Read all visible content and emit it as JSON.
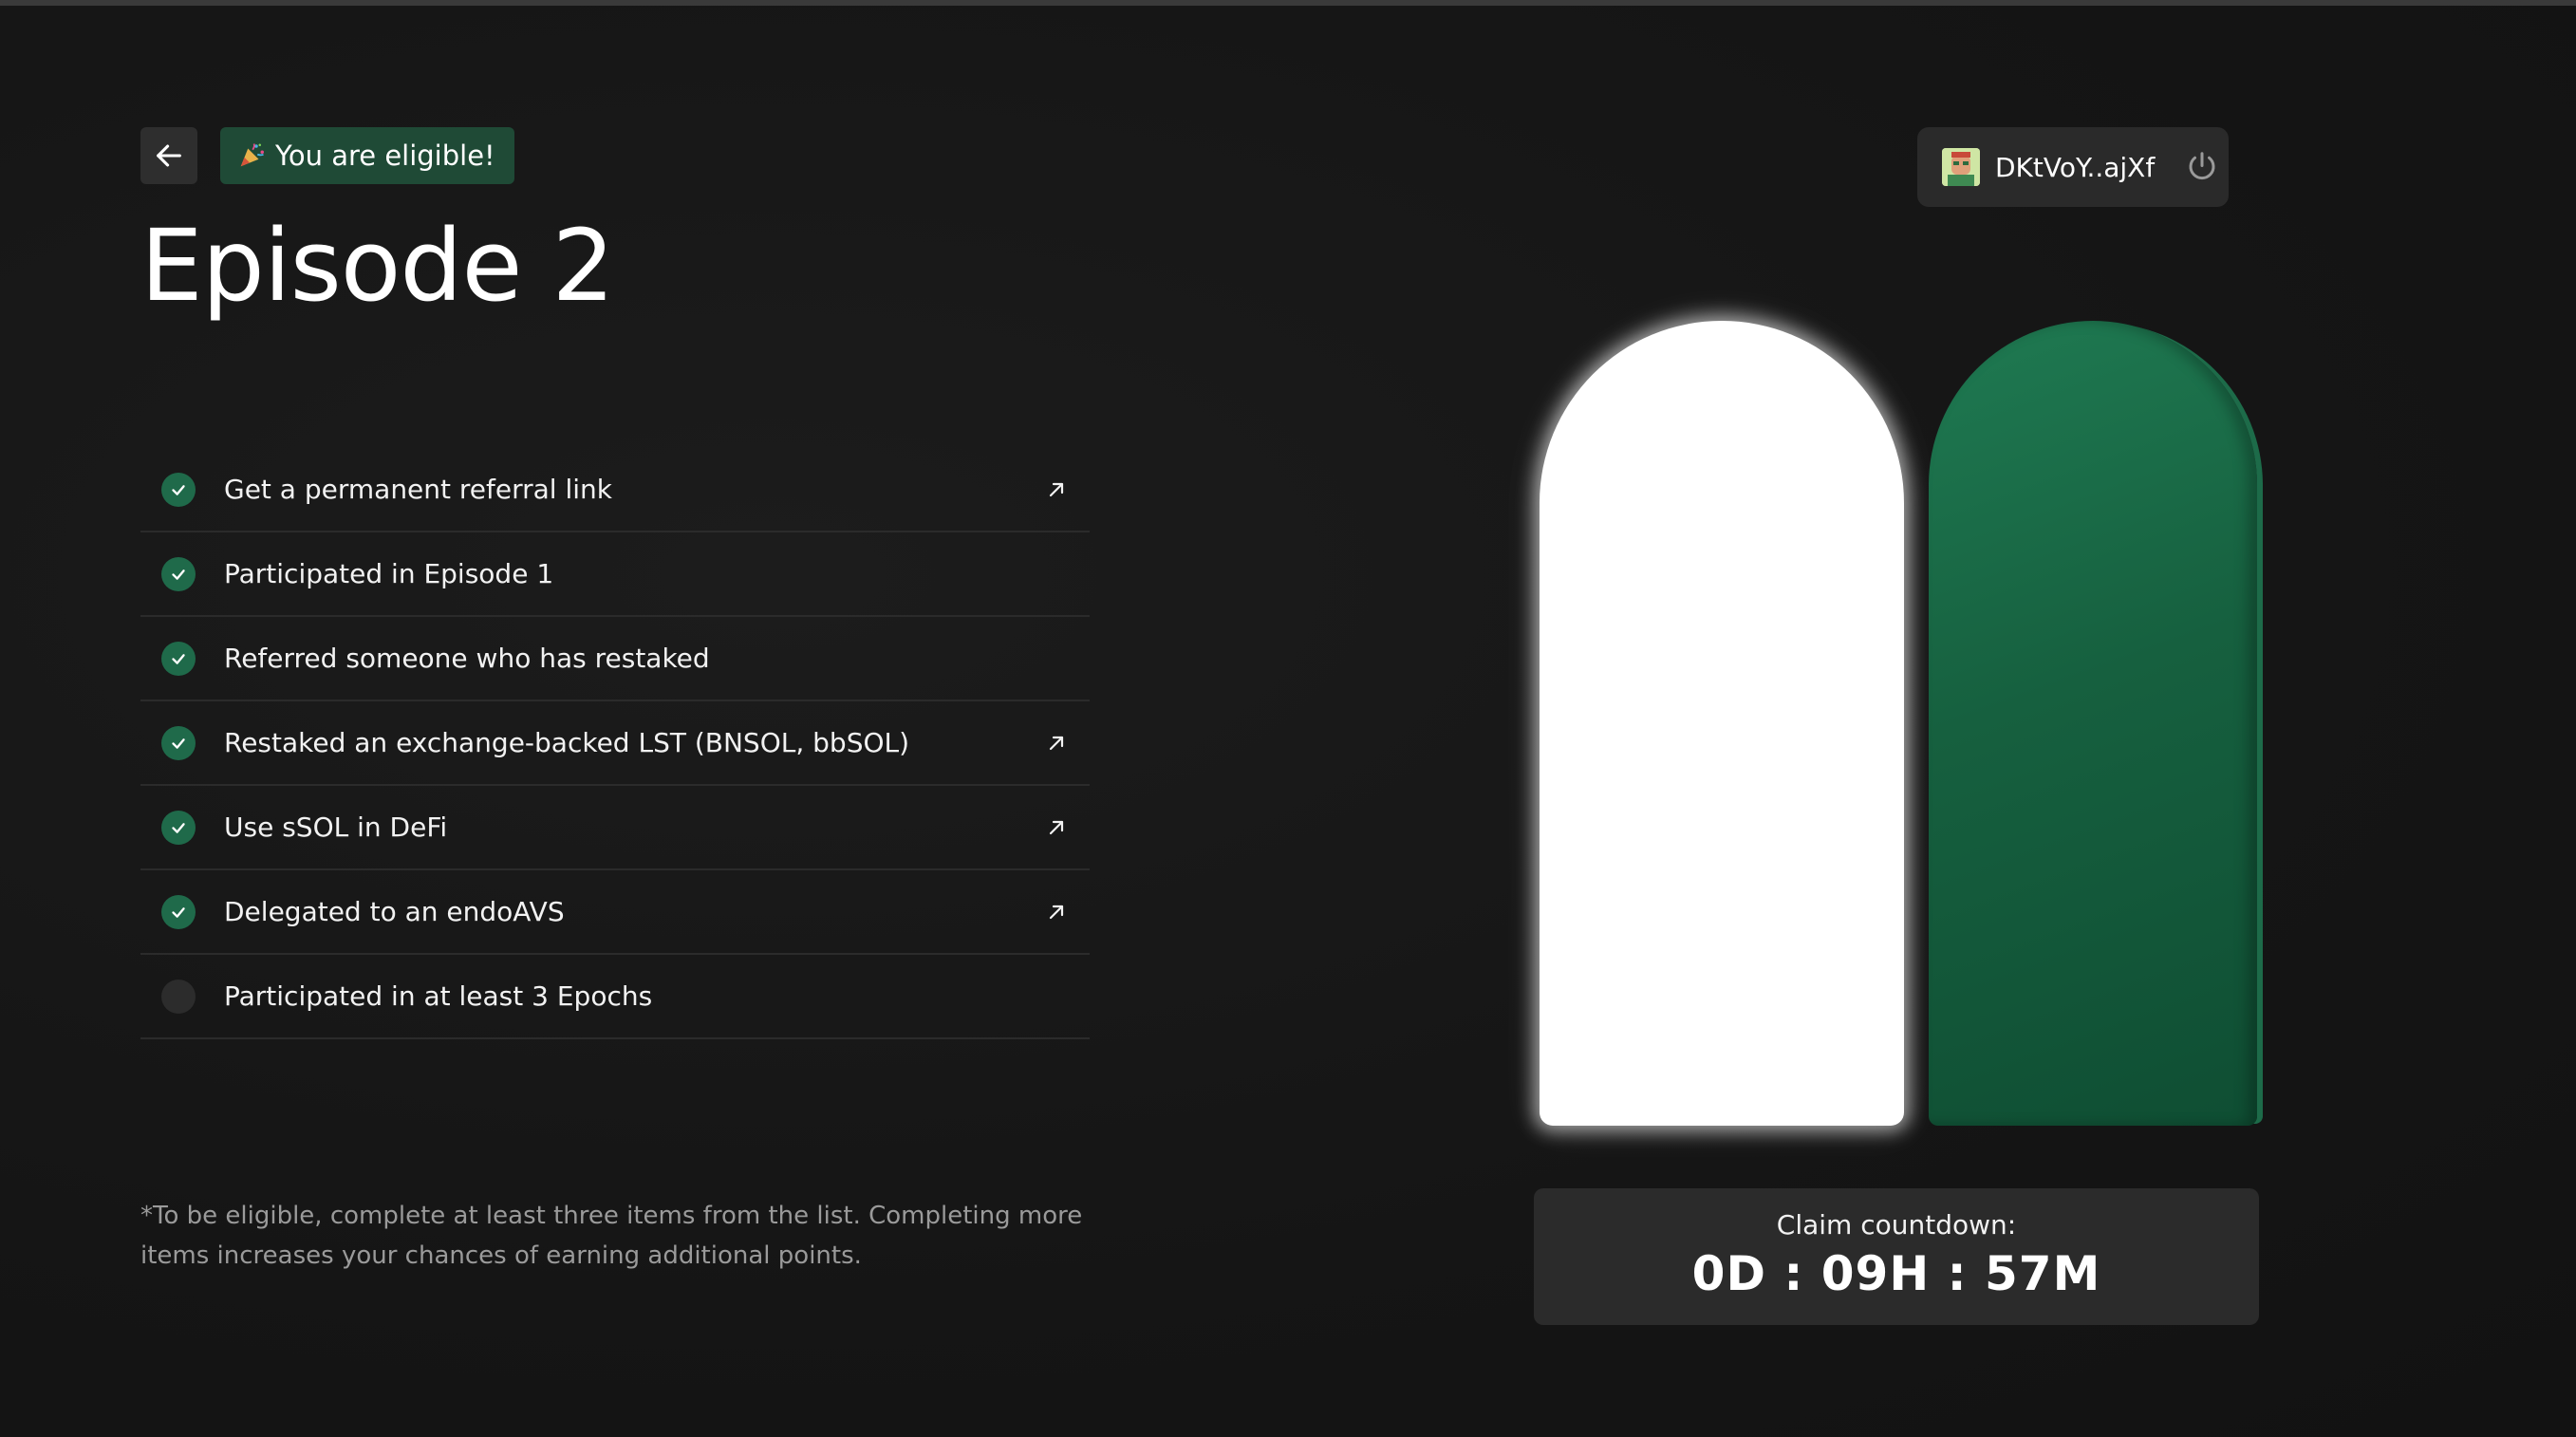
{
  "header": {
    "badge_text": "You are eligible!",
    "title": "Episode 2"
  },
  "wallet": {
    "address": "DKtVoY..ajXf"
  },
  "tasks": [
    {
      "label": "Get a permanent referral link",
      "completed": true,
      "has_link": true
    },
    {
      "label": "Participated in Episode 1",
      "completed": true,
      "has_link": false
    },
    {
      "label": "Referred someone who has restaked",
      "completed": true,
      "has_link": false
    },
    {
      "label": "Restaked an exchange-backed LST (BNSOL, bbSOL)",
      "completed": true,
      "has_link": true
    },
    {
      "label": "Use sSOL in DeFi",
      "completed": true,
      "has_link": true
    },
    {
      "label": "Delegated to an endoAVS",
      "completed": true,
      "has_link": true
    },
    {
      "label": "Participated in at least 3 Epochs",
      "completed": false,
      "has_link": false
    }
  ],
  "footnote": "*To be eligible, complete at least three items from the list. Completing more items increases your chances of earning additional points.",
  "countdown": {
    "label": "Claim countdown:",
    "value": "0D : 09H : 57M"
  },
  "colors": {
    "background": "#161616",
    "accent_green": "#1f6a4a",
    "badge_green": "#1f4a36",
    "arch_white": "#ffffff",
    "arch_green": "#16603f"
  },
  "icons": {
    "back": "arrow-left-icon",
    "badge": "party-popper-icon",
    "wallet_avatar": "avatar-icon",
    "power": "power-icon",
    "check": "check-icon",
    "link": "arrow-up-right-icon"
  }
}
